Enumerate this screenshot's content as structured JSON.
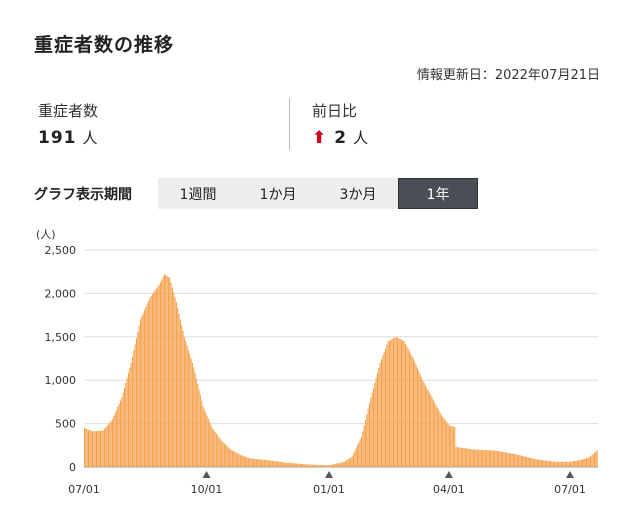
{
  "header": {
    "title": "重症者数の推移",
    "updated": "情報更新日：2022年07月21日"
  },
  "stats": {
    "severe": {
      "label": "重症者数",
      "value": "191",
      "unit": "人"
    },
    "diff": {
      "label": "前日比",
      "value": "2",
      "unit": "人",
      "direction": "up",
      "arrow": "⬆",
      "color": "#d0021b"
    }
  },
  "period": {
    "label": "グラフ表示期間",
    "tabs": [
      {
        "label": "1週間"
      },
      {
        "label": "1か月"
      },
      {
        "label": "3か月"
      },
      {
        "label": "1年"
      }
    ],
    "selected": "1年"
  },
  "chart_data": {
    "type": "bar",
    "ylabel": "(人)",
    "ylim": [
      0,
      2500
    ],
    "yticks": [
      0,
      500,
      1000,
      1500,
      2000,
      2500
    ],
    "ytick_labels": [
      "0",
      "500",
      "1,000",
      "1,500",
      "2,000",
      "2,500"
    ],
    "xtick_labels": [
      "07/01",
      "10/01",
      "01/01",
      "04/01",
      "07/01"
    ],
    "grid": true,
    "bar_color": "#f5a04a",
    "keypoints": [
      [
        "2021-07-01",
        450
      ],
      [
        "2021-07-07",
        410
      ],
      [
        "2021-07-15",
        420
      ],
      [
        "2021-07-22",
        550
      ],
      [
        "2021-07-29",
        800
      ],
      [
        "2021-08-05",
        1200
      ],
      [
        "2021-08-12",
        1700
      ],
      [
        "2021-08-19",
        1950
      ],
      [
        "2021-08-26",
        2100
      ],
      [
        "2021-08-30",
        2220
      ],
      [
        "2021-09-03",
        2180
      ],
      [
        "2021-09-08",
        1900
      ],
      [
        "2021-09-14",
        1500
      ],
      [
        "2021-09-21",
        1150
      ],
      [
        "2021-09-28",
        700
      ],
      [
        "2021-10-05",
        450
      ],
      [
        "2021-10-12",
        300
      ],
      [
        "2021-10-19",
        200
      ],
      [
        "2021-10-26",
        140
      ],
      [
        "2021-11-02",
        100
      ],
      [
        "2021-11-15",
        80
      ],
      [
        "2021-11-30",
        50
      ],
      [
        "2021-12-15",
        30
      ],
      [
        "2021-12-31",
        20
      ],
      [
        "2022-01-05",
        35
      ],
      [
        "2022-01-12",
        60
      ],
      [
        "2022-01-18",
        120
      ],
      [
        "2022-01-25",
        350
      ],
      [
        "2022-02-01",
        800
      ],
      [
        "2022-02-08",
        1200
      ],
      [
        "2022-02-14",
        1450
      ],
      [
        "2022-02-20",
        1500
      ],
      [
        "2022-02-26",
        1450
      ],
      [
        "2022-03-05",
        1250
      ],
      [
        "2022-03-12",
        1000
      ],
      [
        "2022-03-19",
        800
      ],
      [
        "2022-03-26",
        600
      ],
      [
        "2022-04-01",
        480
      ],
      [
        "2022-04-05",
        460
      ],
      [
        "2022-04-06",
        230
      ],
      [
        "2022-04-20",
        200
      ],
      [
        "2022-05-05",
        190
      ],
      [
        "2022-05-20",
        150
      ],
      [
        "2022-06-05",
        90
      ],
      [
        "2022-06-20",
        60
      ],
      [
        "2022-06-30",
        60
      ],
      [
        "2022-07-08",
        80
      ],
      [
        "2022-07-15",
        110
      ],
      [
        "2022-07-21",
        191
      ]
    ]
  }
}
